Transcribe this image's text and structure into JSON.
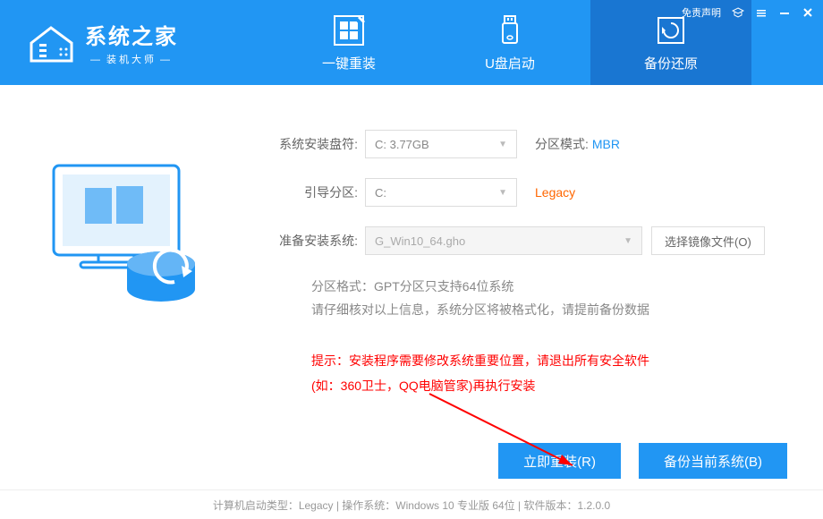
{
  "header": {
    "logo_title": "系统之家",
    "logo_sub": "装机大师",
    "disclaimer": "免责声明"
  },
  "tabs": [
    {
      "label": "一键重装"
    },
    {
      "label": "U盘启动"
    },
    {
      "label": "备份还原"
    }
  ],
  "form": {
    "install_drive_label": "系统安装盘符:",
    "install_drive_value": "C: 3.77GB",
    "partition_mode_label": "分区模式:",
    "partition_mode_value": "MBR",
    "boot_partition_label": "引导分区:",
    "boot_partition_value": "C:",
    "boot_type": "Legacy",
    "prepare_system_label": "准备安装系统:",
    "prepare_system_value": "G_Win10_64.gho",
    "choose_image_btn": "选择镜像文件(O)"
  },
  "info": {
    "line1": "分区格式：GPT分区只支持64位系统",
    "line2": "请仔细核对以上信息，系统分区将被格式化，请提前备份数据"
  },
  "warning": {
    "line1": "提示：安装程序需要修改系统重要位置，请退出所有安全软件",
    "line2": "(如：360卫士，QQ电脑管家)再执行安装"
  },
  "buttons": {
    "reinstall": "立即重装(R)",
    "backup": "备份当前系统(B)"
  },
  "footer": {
    "text": "计算机启动类型：Legacy | 操作系统：Windows 10 专业版 64位 | 软件版本：1.2.0.0"
  }
}
